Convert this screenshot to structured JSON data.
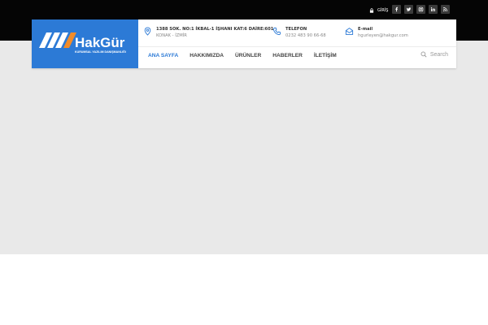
{
  "topbar": {
    "login_label": "GİRİŞ",
    "login_icon": "lock-icon",
    "socials": [
      {
        "icon": "facebook-icon",
        "glyph": "f"
      },
      {
        "icon": "twitter-icon",
        "glyph": "t"
      },
      {
        "icon": "instagram-icon",
        "glyph": "i"
      },
      {
        "icon": "linkedin-icon",
        "glyph": "in"
      },
      {
        "icon": "rss-icon",
        "glyph": "rss"
      }
    ]
  },
  "logo": {
    "brand": "HakGür",
    "tagline": "KURUMSAL YAZILIM DANIŞMANLIĞI",
    "bg_color": "#2c7ad6"
  },
  "contact": {
    "address": {
      "title": "1388 SOK. NO:1 İKBAL-1 İŞHANI KAT:6 DAİRE:601",
      "sub": "KONAK - İZMİR",
      "icon": "location-pin-icon"
    },
    "phone": {
      "title": "TELEFON",
      "sub": "0232 483 90 66-68",
      "icon": "phone-icon"
    },
    "email": {
      "title": "E-mail",
      "sub": "hgurleyen@hakgur.com",
      "icon": "envelope-icon"
    }
  },
  "nav": {
    "items": [
      "ANA SAYFA",
      "HAKKIMIZDA",
      "ÜRÜNLER",
      "HABERLER",
      "İLETİŞİM"
    ],
    "active_index": 0
  },
  "search": {
    "placeholder": "Search",
    "icon": "search-icon"
  },
  "colors": {
    "accent": "#2c7ad6",
    "topbar": "#050505",
    "hero": "#e9e9e9"
  }
}
